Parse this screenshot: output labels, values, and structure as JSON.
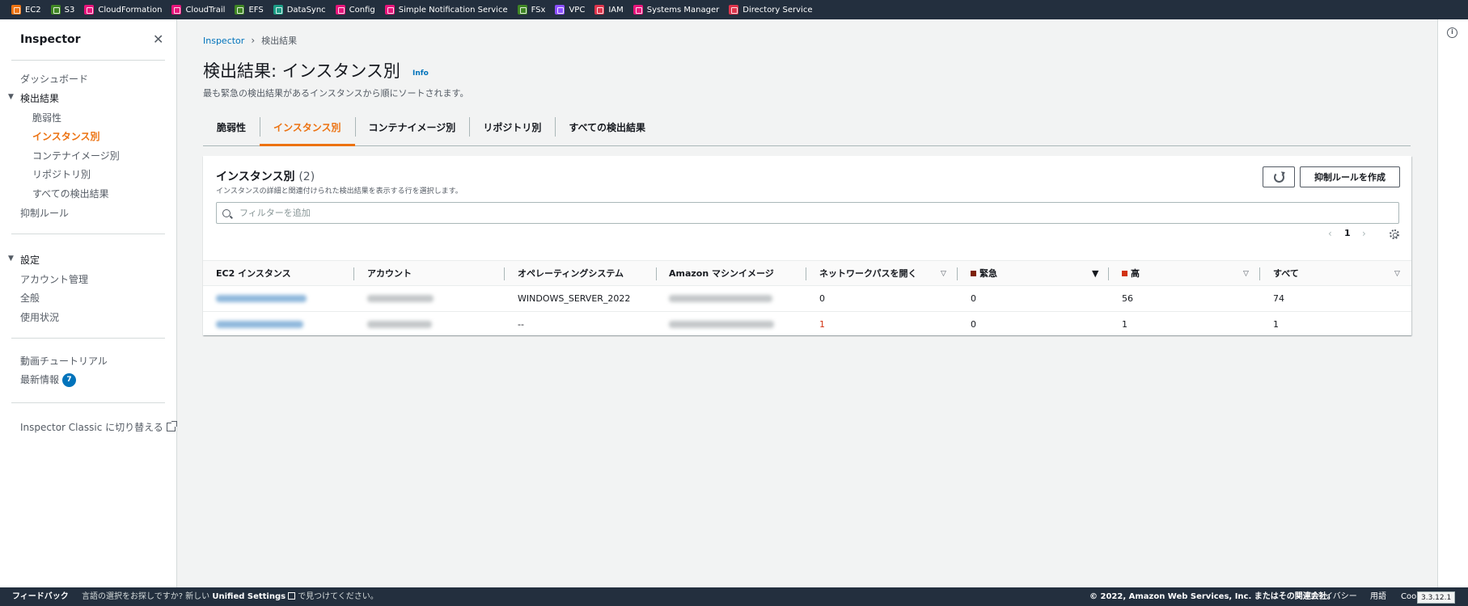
{
  "services": [
    {
      "label": "EC2",
      "color": "#ec7211"
    },
    {
      "label": "S3",
      "color": "#3f8624"
    },
    {
      "label": "CloudFormation",
      "color": "#e7157b"
    },
    {
      "label": "CloudTrail",
      "color": "#e7157b"
    },
    {
      "label": "EFS",
      "color": "#3f8624"
    },
    {
      "label": "DataSync",
      "color": "#1b9c85"
    },
    {
      "label": "Config",
      "color": "#e7157b"
    },
    {
      "label": "Simple Notification Service",
      "color": "#e7157b"
    },
    {
      "label": "FSx",
      "color": "#3f8624"
    },
    {
      "label": "VPC",
      "color": "#8c4fff"
    },
    {
      "label": "IAM",
      "color": "#dd344c"
    },
    {
      "label": "Systems Manager",
      "color": "#e7157b"
    },
    {
      "label": "Directory Service",
      "color": "#dd344c"
    }
  ],
  "sidebar": {
    "title": "Inspector",
    "dashboard": "ダッシュボード",
    "findings_group": "検出結果",
    "findings_items": [
      "脆弱性",
      "インスタンス別",
      "コンテナイメージ別",
      "リポジトリ別",
      "すべての検出結果"
    ],
    "suppression": "抑制ルール",
    "settings_group": "設定",
    "settings_items": [
      "アカウント管理",
      "全般",
      "使用状況"
    ],
    "video": "動画チュートリアル",
    "whats_new": "最新情報",
    "whats_new_badge": "7",
    "classic": "Inspector Classic に切り替える"
  },
  "breadcrumb": {
    "root": "Inspector",
    "current": "検出結果"
  },
  "page": {
    "title": "検出結果: インスタンス別",
    "info": "Info",
    "description": "最も緊急の検出結果があるインスタンスから順にソートされます。"
  },
  "tabs": [
    "脆弱性",
    "インスタンス別",
    "コンテナイメージ別",
    "リポジトリ別",
    "すべての検出結果"
  ],
  "panel": {
    "title": "インスタンス別",
    "count": "(2)",
    "description": "インスタンスの詳細と関連付けられた検出結果を表示する行を選択します。",
    "create_button": "抑制ルールを作成",
    "filter_placeholder": "フィルターを追加",
    "page_number": "1"
  },
  "columns": {
    "instance": "EC2 インスタンス",
    "account": "アカウント",
    "os": "オペレーティングシステム",
    "ami": "Amazon マシンイメージ",
    "network": "ネットワークパスを開く",
    "critical": "緊急",
    "high": "高",
    "all": "すべて"
  },
  "severity_colors": {
    "critical": "#7d2105",
    "high": "#d13212",
    "link": "#0073bb",
    "accent": "#ec7211"
  },
  "rows": [
    {
      "os": "WINDOWS_SERVER_2022",
      "network": "0",
      "critical": "0",
      "high": "56",
      "all": "74"
    },
    {
      "os": "--",
      "network": "1",
      "critical": "0",
      "high": "1",
      "all": "1"
    }
  ],
  "footer": {
    "feedback": "フィードバック",
    "lang_prefix": "言語の選択をお探しですか? 新しい",
    "unified": "Unified Settings",
    "lang_suffix": "で見つけてください。",
    "copyright": "© 2022, Amazon Web Services, Inc. またはその関連会社。",
    "privacy": "プライバシー",
    "terms": "用語",
    "cookie": "Cookie",
    "version": "3.3.12.1"
  }
}
